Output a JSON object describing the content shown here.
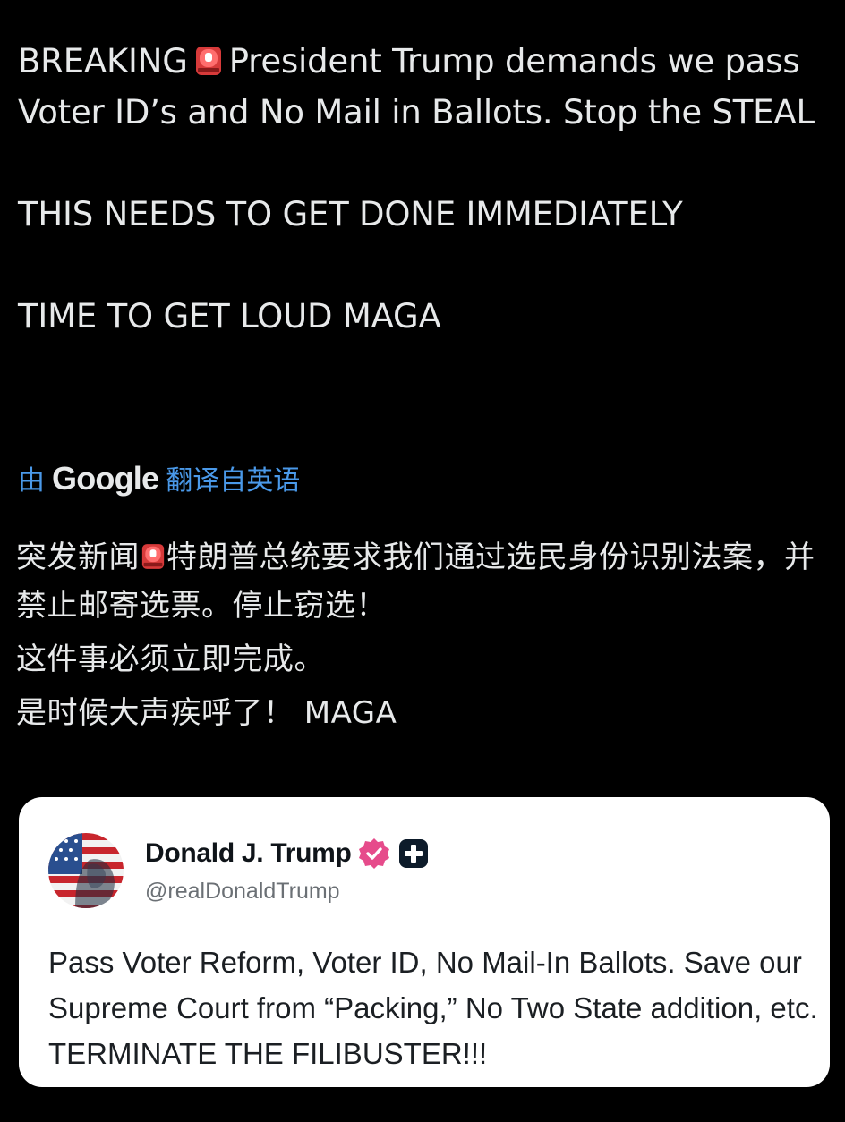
{
  "post": {
    "line1_a": "BREAKING",
    "line1_b": "President Trump demands we pass Voter ID’s and No Mail in Ballots. Stop the STEAL",
    "line2": "THIS NEEDS TO GET DONE IMMEDIATELY",
    "line3": "TIME TO GET LOUD MAGA",
    "emoji": "rotating-light-icon"
  },
  "translation": {
    "prefix": "由",
    "brand": "Google",
    "suffix": "翻译自英语",
    "zh_line1_a": "突发新闻",
    "zh_line1_b": "特朗普总统要求我们通过选民身份识别法案，并禁止邮寄选票。停止窃选！",
    "zh_line2": "这件事必须立即完成。",
    "zh_line3": "是时候大声疾呼了！ MAGA"
  },
  "quoted_post": {
    "display_name": "Donald J. Trump",
    "handle": "@realDonaldTrump",
    "verified_icon": "verified-badge-icon",
    "platform_icon": "plus-square-icon",
    "text": "Pass Voter Reform, Voter ID, No Mail-In Ballots. Save our Supreme Court from “Packing,” No Two State addition, etc. TERMINATE THE FILIBUSTER!!!"
  },
  "colors": {
    "background": "#000000",
    "text": "#e7e9ea",
    "link": "#4a99e9",
    "card_bg": "#ffffff",
    "verified_pink": "#e64b8b"
  }
}
